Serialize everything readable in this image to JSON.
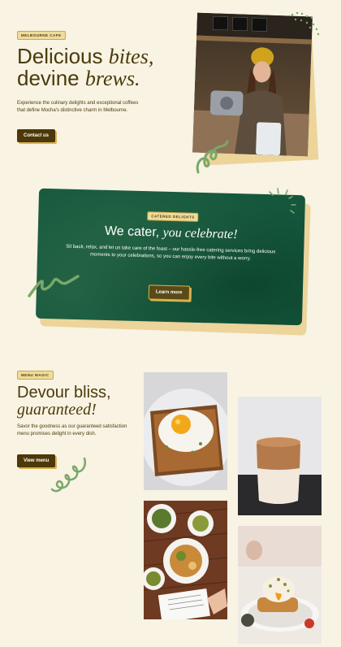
{
  "hero": {
    "badge": "MELBOURNE CAFE",
    "title_line1_plain": "Delicious",
    "title_line1_italic": "bites,",
    "title_line2_plain": "devine",
    "title_line2_italic": "brews.",
    "description": "Experience the culinary delights and exceptional coffees that define Mocha's distinctive charm in Melbourne.",
    "button_label": "Contact us"
  },
  "catering": {
    "badge": "CATERED DELIGHTS",
    "title_plain": "We cater,",
    "title_italic": "you celebrate!",
    "description": "Sit back, relax, and let us take care of the feast – our hassle-free catering services bring delicious moments to your celebrations, so you can enjoy every bite without a worry.",
    "button_label": "Learn more"
  },
  "menu": {
    "badge": "MENU MAGIC",
    "title_plain": "Devour bliss,",
    "title_italic": "guaranteed!",
    "description": "Savor the goodness as our guaranteed satisfaction menu promises delight in every dish.",
    "button_label": "View menu"
  },
  "colors": {
    "background": "#f8f3e3",
    "brand_brown": "#4c3808",
    "accent_gold": "#d9b24f",
    "banner_green": "#14573c",
    "squiggle_green": "#7aa86a"
  }
}
